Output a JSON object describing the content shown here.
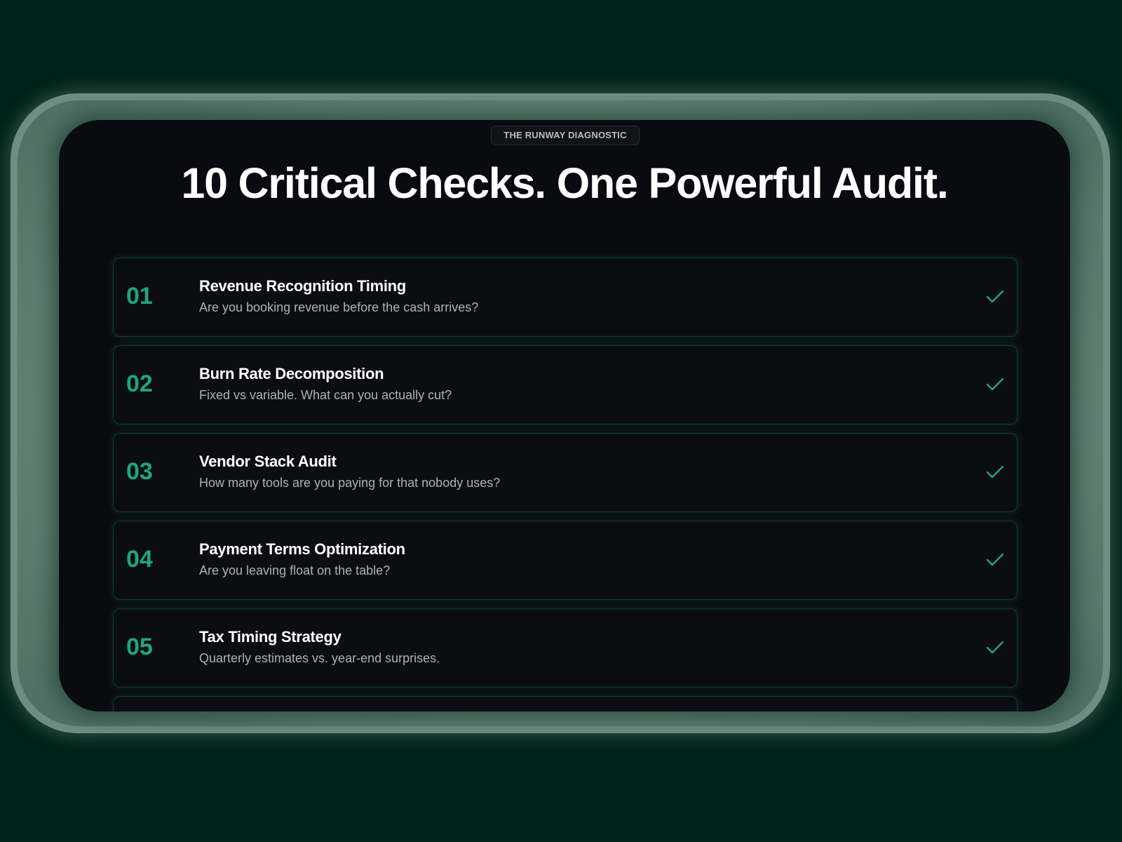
{
  "badge": "THE RUNWAY DIAGNOSTIC",
  "title": "10 Critical Checks. One Powerful Audit.",
  "colors": {
    "background": "#012319",
    "screen": "#0a0b10",
    "accent": "#1fa67c",
    "text": "#ffffff",
    "muted": "#aeb1b8"
  },
  "checks": [
    {
      "number": "01",
      "title": "Revenue Recognition Timing",
      "description": "Are you booking revenue before the cash arrives?",
      "icon": "check-icon"
    },
    {
      "number": "02",
      "title": "Burn Rate Decomposition",
      "description": "Fixed vs variable. What can you actually cut?",
      "icon": "check-icon"
    },
    {
      "number": "03",
      "title": "Vendor Stack Audit",
      "description": "How many tools are you paying for that nobody uses?",
      "icon": "check-icon"
    },
    {
      "number": "04",
      "title": "Payment Terms Optimization",
      "description": "Are you leaving float on the table?",
      "icon": "check-icon"
    },
    {
      "number": "05",
      "title": "Tax Timing Strategy",
      "description": "Quarterly estimates vs. year-end surprises.",
      "icon": "check-icon"
    }
  ]
}
